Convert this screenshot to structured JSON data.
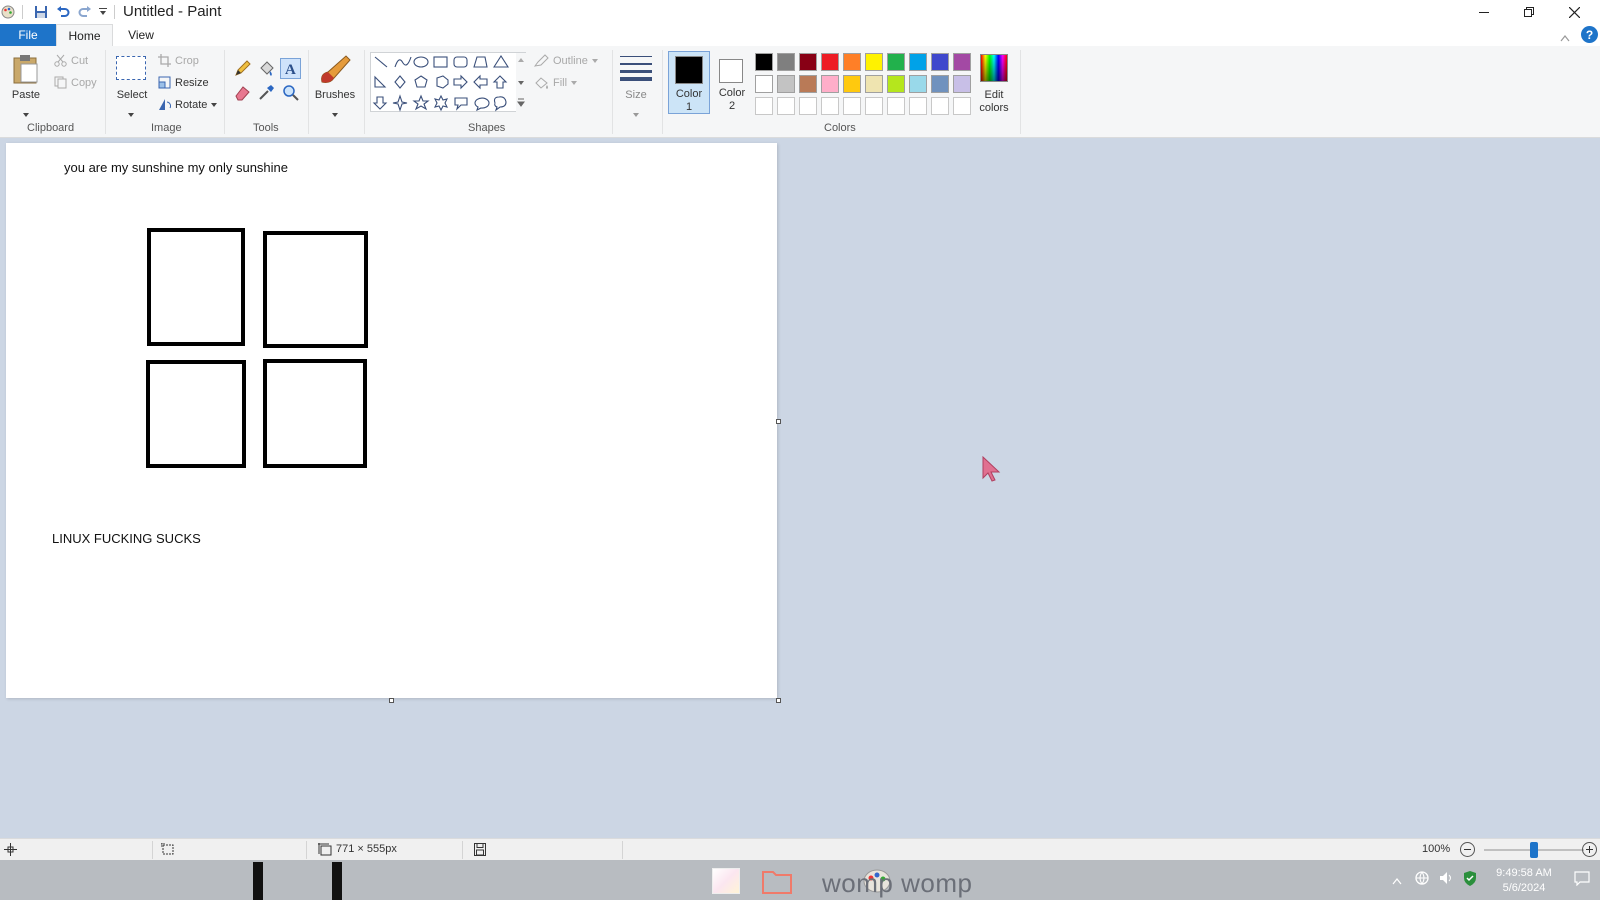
{
  "window": {
    "title": "Untitled - Paint"
  },
  "tabs": [
    {
      "label": "File"
    },
    {
      "label": "Home"
    },
    {
      "label": "View"
    }
  ],
  "ribbon": {
    "clipboard": {
      "paste": "Paste",
      "cut": "Cut",
      "copy": "Copy",
      "group": "Clipboard"
    },
    "image": {
      "select": "Select",
      "crop": "Crop",
      "resize": "Resize",
      "rotate": "Rotate",
      "group": "Image"
    },
    "tools": {
      "group": "Tools"
    },
    "brushes": {
      "label": "Brushes"
    },
    "shapes": {
      "outline": "Outline",
      "fill": "Fill",
      "group": "Shapes"
    },
    "size": {
      "label": "Size"
    },
    "colors": {
      "color1_label": "Color\n1",
      "color2_label": "Color\n2",
      "edit_label": "Edit\ncolors",
      "group": "Colors",
      "color1": "#000000",
      "color2": "#ffffff",
      "palette_row1": [
        "#000000",
        "#7f7f7f",
        "#880015",
        "#ed1c24",
        "#ff7f27",
        "#fff200",
        "#22b14c",
        "#00a2e8",
        "#3f48cc",
        "#a349a4"
      ],
      "palette_row2": [
        "#ffffff",
        "#c3c3c3",
        "#b97a57",
        "#ffaec9",
        "#ffc90e",
        "#efe4b0",
        "#b5e61d",
        "#99d9ea",
        "#7092be",
        "#c8bfe7"
      ],
      "palette_row3": [
        "#ffffff",
        "#ffffff",
        "#ffffff",
        "#ffffff",
        "#ffffff",
        "#ffffff",
        "#ffffff",
        "#ffffff",
        "#ffffff",
        "#ffffff"
      ]
    }
  },
  "canvas": {
    "text_top": "you are my sunshine my only sunshine",
    "text_bottom": "LINUX FUCKING SUCKS"
  },
  "statusbar": {
    "canvas_size": "771 × 555px",
    "zoom": "100%",
    "zoom_fraction": 0.5
  },
  "taskbar": {
    "app_label": "womp womp",
    "time": "9:49:58 AM",
    "date": "5/6/2024"
  }
}
